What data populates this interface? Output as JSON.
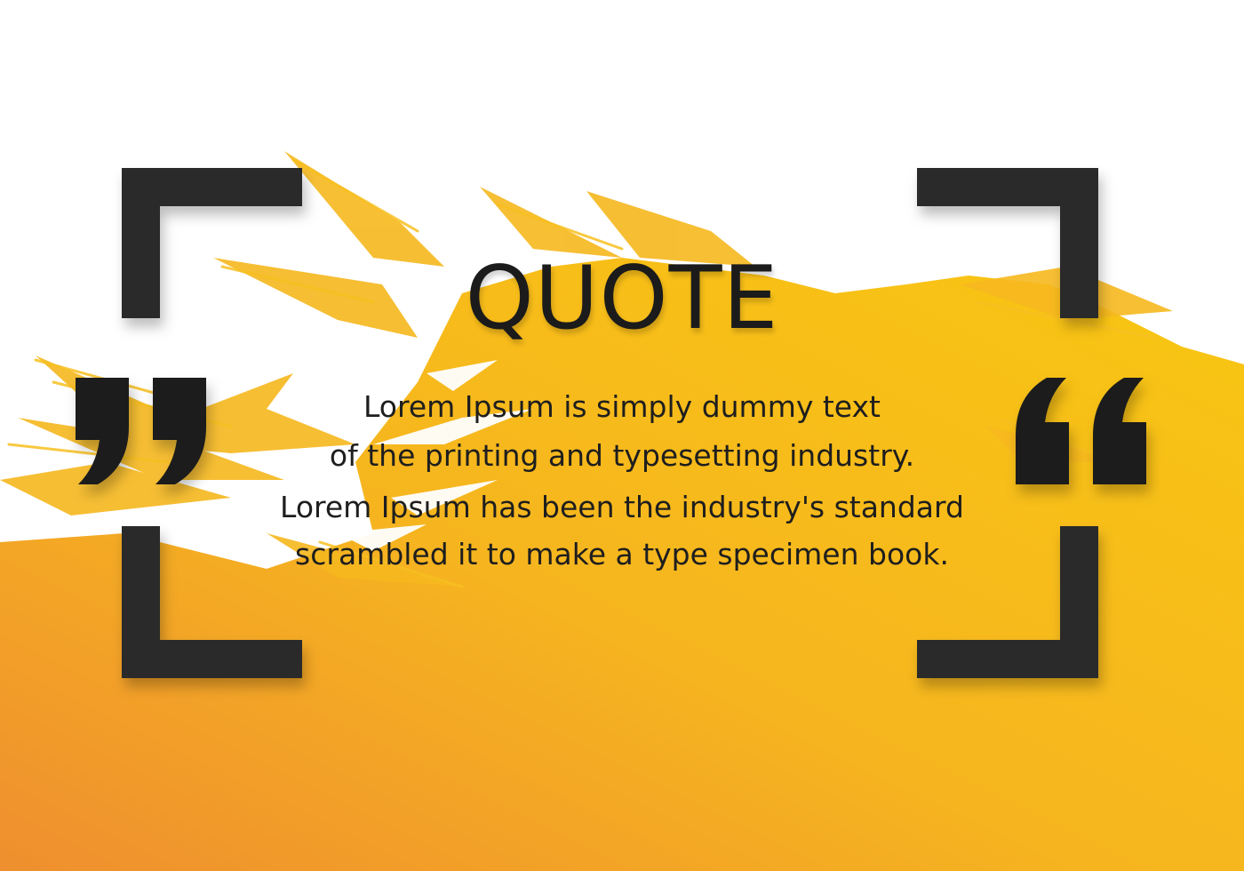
{
  "title": "QUOTE",
  "lines": [
    "Lorem Ipsum is simply dummy text",
    "of the printing and typesetting industry.",
    "Lorem Ipsum has been the industry's standard",
    "scrambled it to make a type specimen book."
  ],
  "colors": {
    "background": "#ffffff",
    "yellow": "#f7c416",
    "orange": "#f09a30",
    "frame": "#2a2a2a",
    "text": "#1e1e1e"
  },
  "icons": {
    "left_quote": "closing-quote-icon",
    "right_quote": "opening-quote-icon"
  }
}
